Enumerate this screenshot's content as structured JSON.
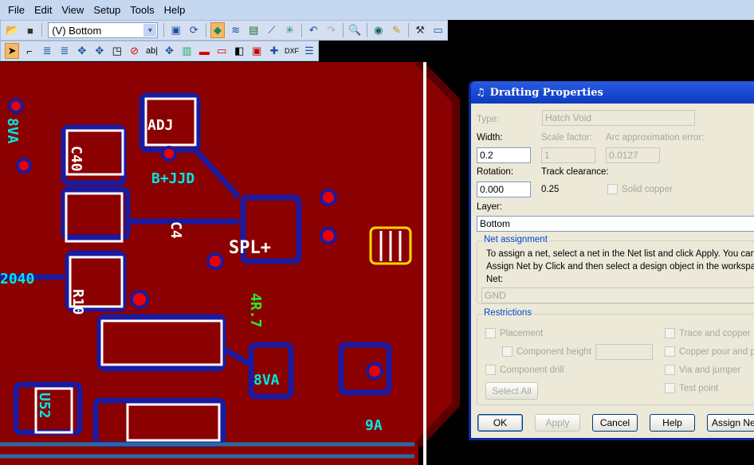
{
  "menu": [
    "File",
    "Edit",
    "View",
    "Setup",
    "Tools",
    "Help"
  ],
  "toolbar": {
    "layer_select": "(V) Bottom"
  },
  "pcb": {
    "labels": [
      "SPL+",
      "B+JJD",
      "4R.7",
      "8VA",
      "R10",
      "C40",
      "U52",
      "C4",
      "ADJ",
      "8VA",
      "2040",
      "9A"
    ]
  },
  "dialog": {
    "title": "Drafting Properties",
    "type_label": "Type:",
    "type_value": "Hatch Void",
    "width_label": "Width:",
    "width_value": "0.2",
    "scale_label": "Scale factor:",
    "scale_value": "1",
    "arc_label": "Arc approximation error:",
    "arc_value": "0.0127",
    "rotation_label": "Rotation:",
    "rotation_value": "0.000",
    "track_label": "Track clearance:",
    "track_value": "0.25",
    "solid_label": "Solid copper",
    "layer_label": "Layer:",
    "layer_value": "Bottom",
    "net_group": "Net assignment",
    "net_help": "To assign a net, select a net in the Net list and click Apply. You can also",
    "net_help2": "Assign Net by Click and then select a design object in the workspace.",
    "net_label": "Net:",
    "net_value": "GND",
    "restrictions": "Restrictions",
    "placement": "Placement",
    "component_height": "Component height",
    "component_drill": "Component drill",
    "select_all": "Select All",
    "trace": "Trace and copper",
    "copper_pour": "Copper pour and plane",
    "via": "Via and jumper",
    "test_point": "Test point",
    "ok": "OK",
    "apply": "Apply",
    "cancel": "Cancel",
    "help": "Help",
    "assign_net": "Assign Net"
  },
  "colors": {
    "board": "#8b0000",
    "outline": "#1a1aa0",
    "silk": "#ffffff",
    "text": "#00e6e6"
  }
}
